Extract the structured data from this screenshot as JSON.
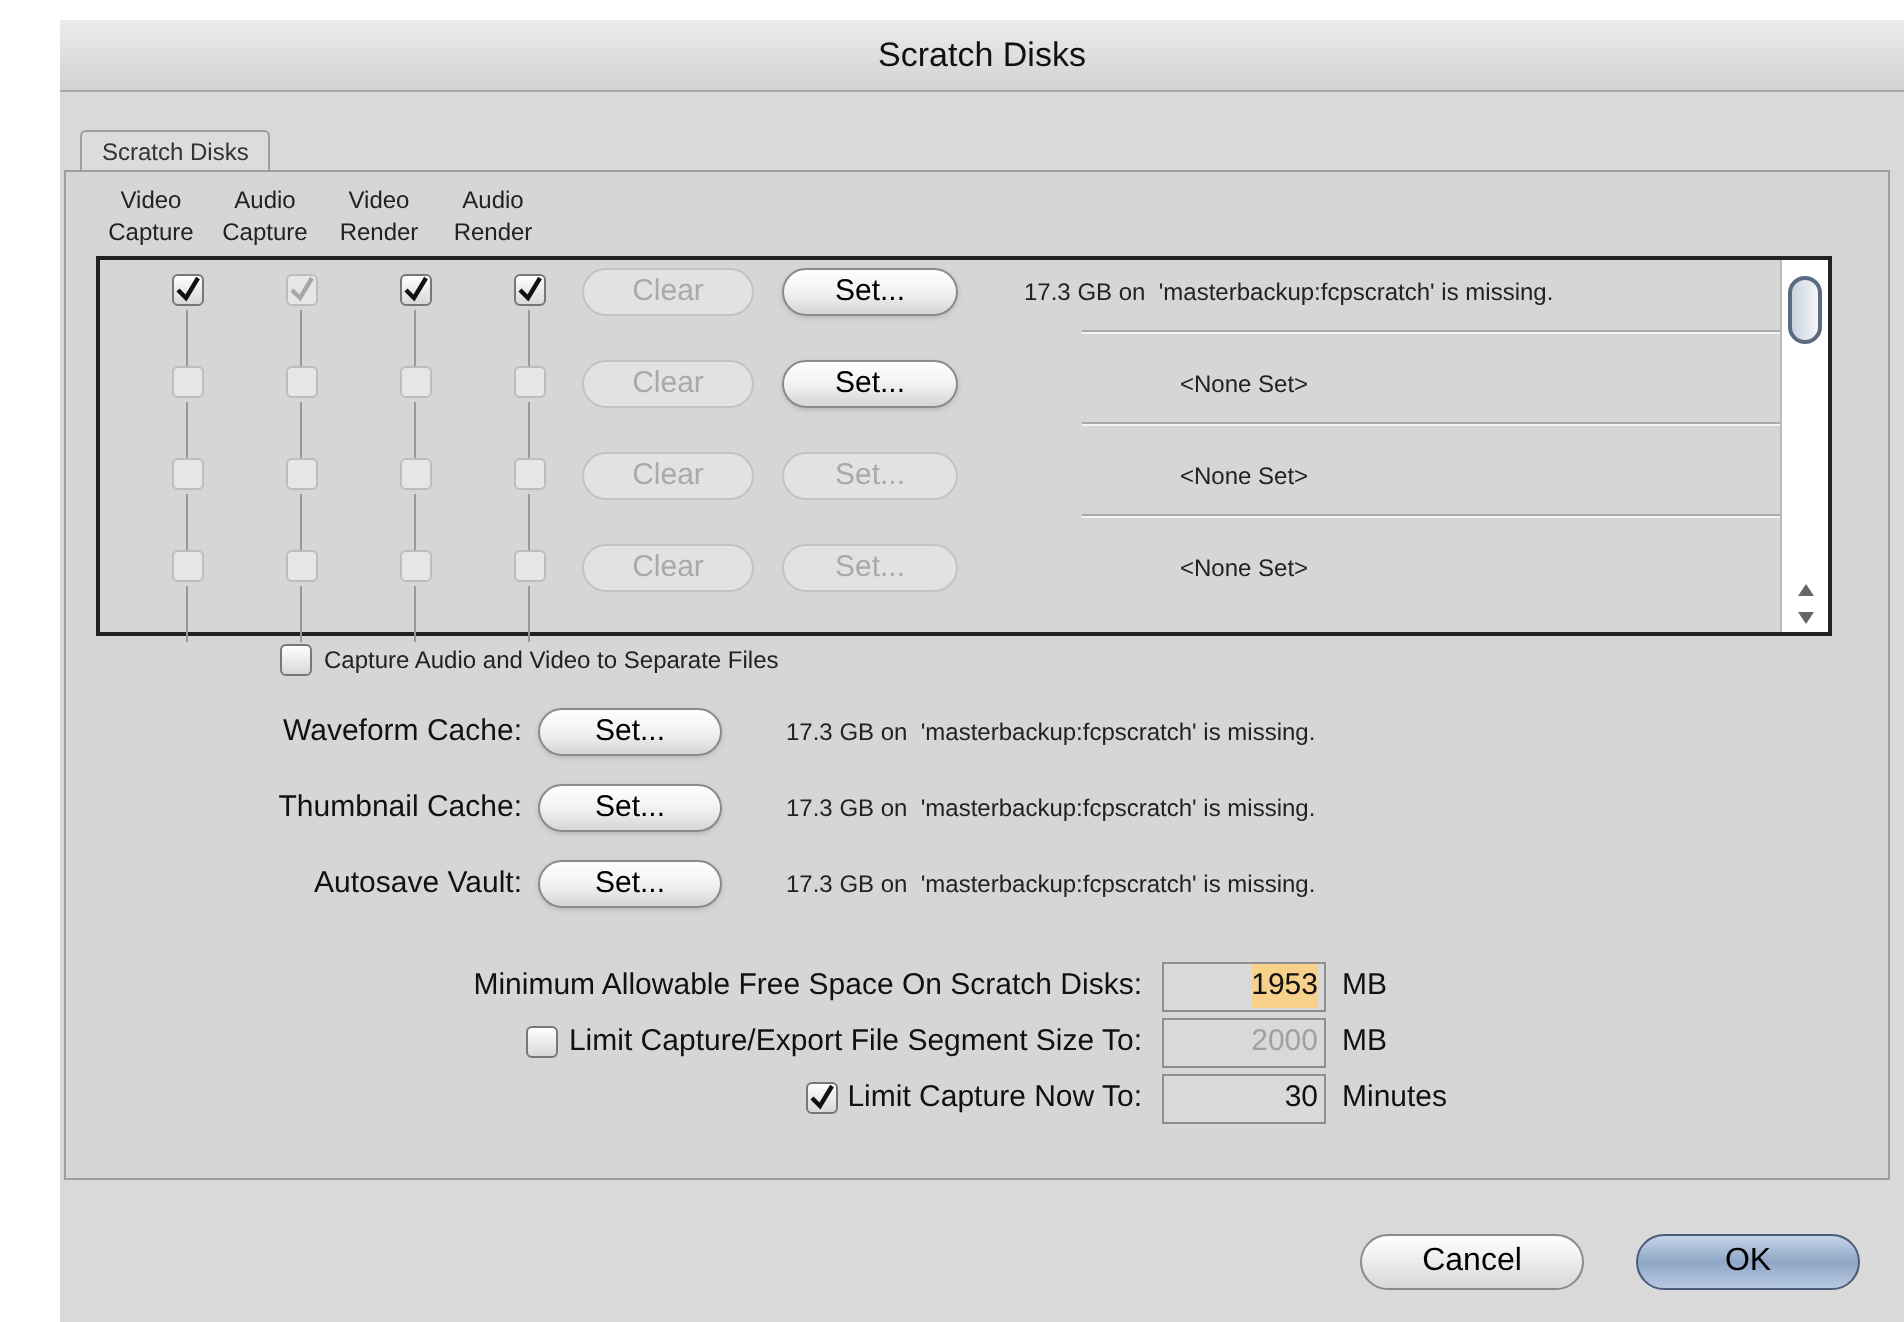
{
  "window": {
    "title": "Scratch Disks"
  },
  "tabs": [
    {
      "label": "Scratch Disks",
      "selected": true
    }
  ],
  "columns": [
    {
      "line1": "Video",
      "line2": "Capture"
    },
    {
      "line1": "Audio",
      "line2": "Capture"
    },
    {
      "line1": "Video",
      "line2": "Render"
    },
    {
      "line1": "Audio",
      "line2": "Render"
    }
  ],
  "disks": [
    {
      "checks": [
        {
          "checked": true,
          "disabled": false
        },
        {
          "checked": true,
          "disabled": true
        },
        {
          "checked": true,
          "disabled": false
        },
        {
          "checked": true,
          "disabled": false
        }
      ],
      "clear": {
        "label": "Clear",
        "disabled": true
      },
      "set": {
        "label": "Set...",
        "disabled": false
      },
      "status": "17.3 GB on  'masterbackup:fcpscratch' is missing.",
      "kind": "set"
    },
    {
      "checks": [
        {
          "checked": false,
          "disabled": true
        },
        {
          "checked": false,
          "disabled": true
        },
        {
          "checked": false,
          "disabled": true
        },
        {
          "checked": false,
          "disabled": true
        }
      ],
      "clear": {
        "label": "Clear",
        "disabled": true
      },
      "set": {
        "label": "Set...",
        "disabled": false
      },
      "status": "<None Set>",
      "kind": "none"
    },
    {
      "checks": [
        {
          "checked": false,
          "disabled": true
        },
        {
          "checked": false,
          "disabled": true
        },
        {
          "checked": false,
          "disabled": true
        },
        {
          "checked": false,
          "disabled": true
        }
      ],
      "clear": {
        "label": "Clear",
        "disabled": true
      },
      "set": {
        "label": "Set...",
        "disabled": true
      },
      "status": "<None Set>",
      "kind": "none"
    },
    {
      "checks": [
        {
          "checked": false,
          "disabled": true
        },
        {
          "checked": false,
          "disabled": true
        },
        {
          "checked": false,
          "disabled": true
        },
        {
          "checked": false,
          "disabled": true
        }
      ],
      "clear": {
        "label": "Clear",
        "disabled": true
      },
      "set": {
        "label": "Set...",
        "disabled": true
      },
      "status": "<None Set>",
      "kind": "none"
    }
  ],
  "separate_files": {
    "label": "Capture Audio and Video to Separate Files",
    "checked": false
  },
  "caches": [
    {
      "label": "Waveform Cache:",
      "button": "Set...",
      "status": "17.3 GB on  'masterbackup:fcpscratch' is missing."
    },
    {
      "label": "Thumbnail Cache:",
      "button": "Set...",
      "status": "17.3 GB on  'masterbackup:fcpscratch' is missing."
    },
    {
      "label": "Autosave Vault:",
      "button": "Set...",
      "status": "17.3 GB on  'masterbackup:fcpscratch' is missing."
    }
  ],
  "limits": [
    {
      "kind": "plain",
      "label": "Minimum Allowable Free Space On Scratch Disks:",
      "value": "1953",
      "unit": "MB",
      "disabled": false,
      "highlighted": true
    },
    {
      "kind": "checkbox",
      "checked": false,
      "label": "Limit Capture/Export File Segment Size To:",
      "value": "2000",
      "unit": "MB",
      "disabled": true,
      "highlighted": false
    },
    {
      "kind": "checkbox",
      "checked": true,
      "label": "Limit Capture Now To:",
      "value": "30",
      "unit": "Minutes",
      "disabled": false,
      "highlighted": false
    }
  ],
  "buttons": [
    {
      "label": "Cancel",
      "default": false
    },
    {
      "label": "OK",
      "default": true
    }
  ]
}
